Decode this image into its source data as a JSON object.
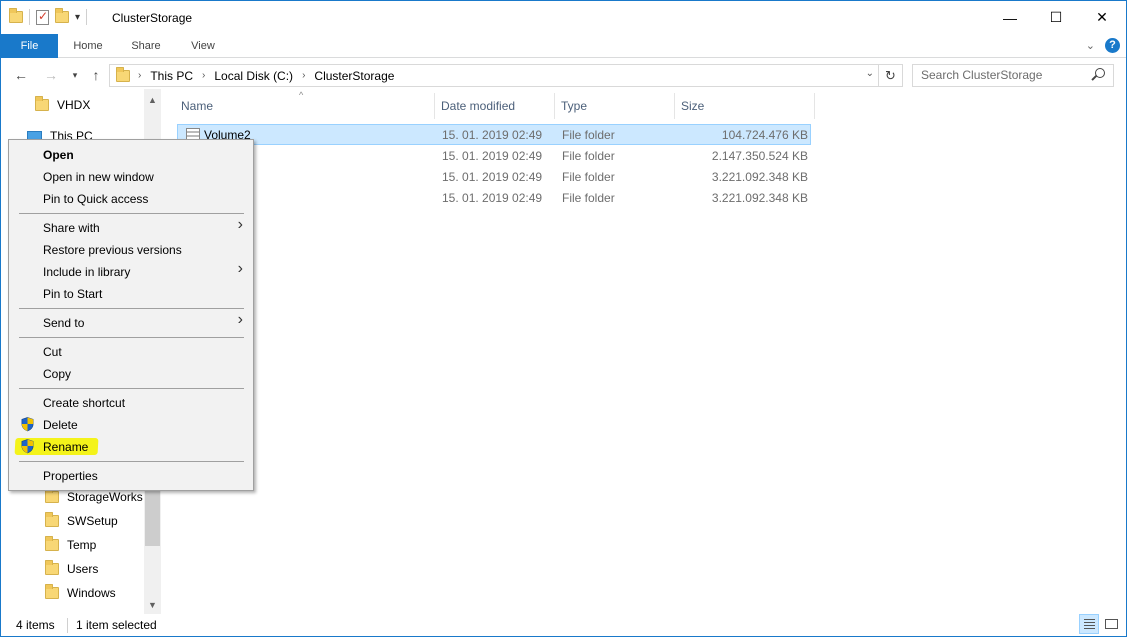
{
  "window": {
    "title": "ClusterStorage",
    "controls": {
      "minimize": "—",
      "maximize": "☐",
      "close": "✕"
    }
  },
  "ribbon": {
    "tabs": [
      "File",
      "Home",
      "Share",
      "View"
    ]
  },
  "address": {
    "crumbs": [
      "This PC",
      "Local Disk (C:)",
      "ClusterStorage"
    ],
    "search_placeholder": "Search ClusterStorage"
  },
  "nav_pane": {
    "items": [
      {
        "label": "VHDX",
        "icon": "folder-icon"
      },
      {
        "label": "This PC",
        "icon": "this-pc-icon"
      },
      {
        "label": "StorageWorks",
        "icon": "folder-icon"
      },
      {
        "label": "SWSetup",
        "icon": "folder-icon"
      },
      {
        "label": "Temp",
        "icon": "folder-icon"
      },
      {
        "label": "Users",
        "icon": "folder-icon"
      },
      {
        "label": "Windows",
        "icon": "folder-icon"
      }
    ]
  },
  "file_list": {
    "columns": [
      "Name",
      "Date modified",
      "Type",
      "Size"
    ],
    "rows": [
      {
        "name": "Volume2",
        "date": "15. 01. 2019 02:49",
        "type": "File folder",
        "size": "104.724.476 KB",
        "selected": true
      },
      {
        "name": "",
        "date": "15. 01. 2019 02:49",
        "type": "File folder",
        "size": "2.147.350.524 KB",
        "selected": false
      },
      {
        "name": "",
        "date": "15. 01. 2019 02:49",
        "type": "File folder",
        "size": "3.221.092.348 KB",
        "selected": false
      },
      {
        "name": "",
        "date": "15. 01. 2019 02:49",
        "type": "File folder",
        "size": "3.221.092.348 KB",
        "selected": false
      }
    ]
  },
  "context_menu": {
    "items": {
      "open": "Open",
      "open_new_window": "Open in new window",
      "pin_quick_access": "Pin to Quick access",
      "share_with": "Share with",
      "restore_previous": "Restore previous versions",
      "include_in_library": "Include in library",
      "pin_to_start": "Pin to Start",
      "send_to": "Send to",
      "cut": "Cut",
      "copy": "Copy",
      "create_shortcut": "Create shortcut",
      "delete": "Delete",
      "rename": "Rename",
      "properties": "Properties"
    },
    "highlight_color": "#f4f31a"
  },
  "status_bar": {
    "item_count": "4 items",
    "selection": "1 item selected"
  },
  "colors": {
    "accent": "#1979ca",
    "selection_bg": "#cce8ff",
    "selection_border": "#99d1ff"
  }
}
